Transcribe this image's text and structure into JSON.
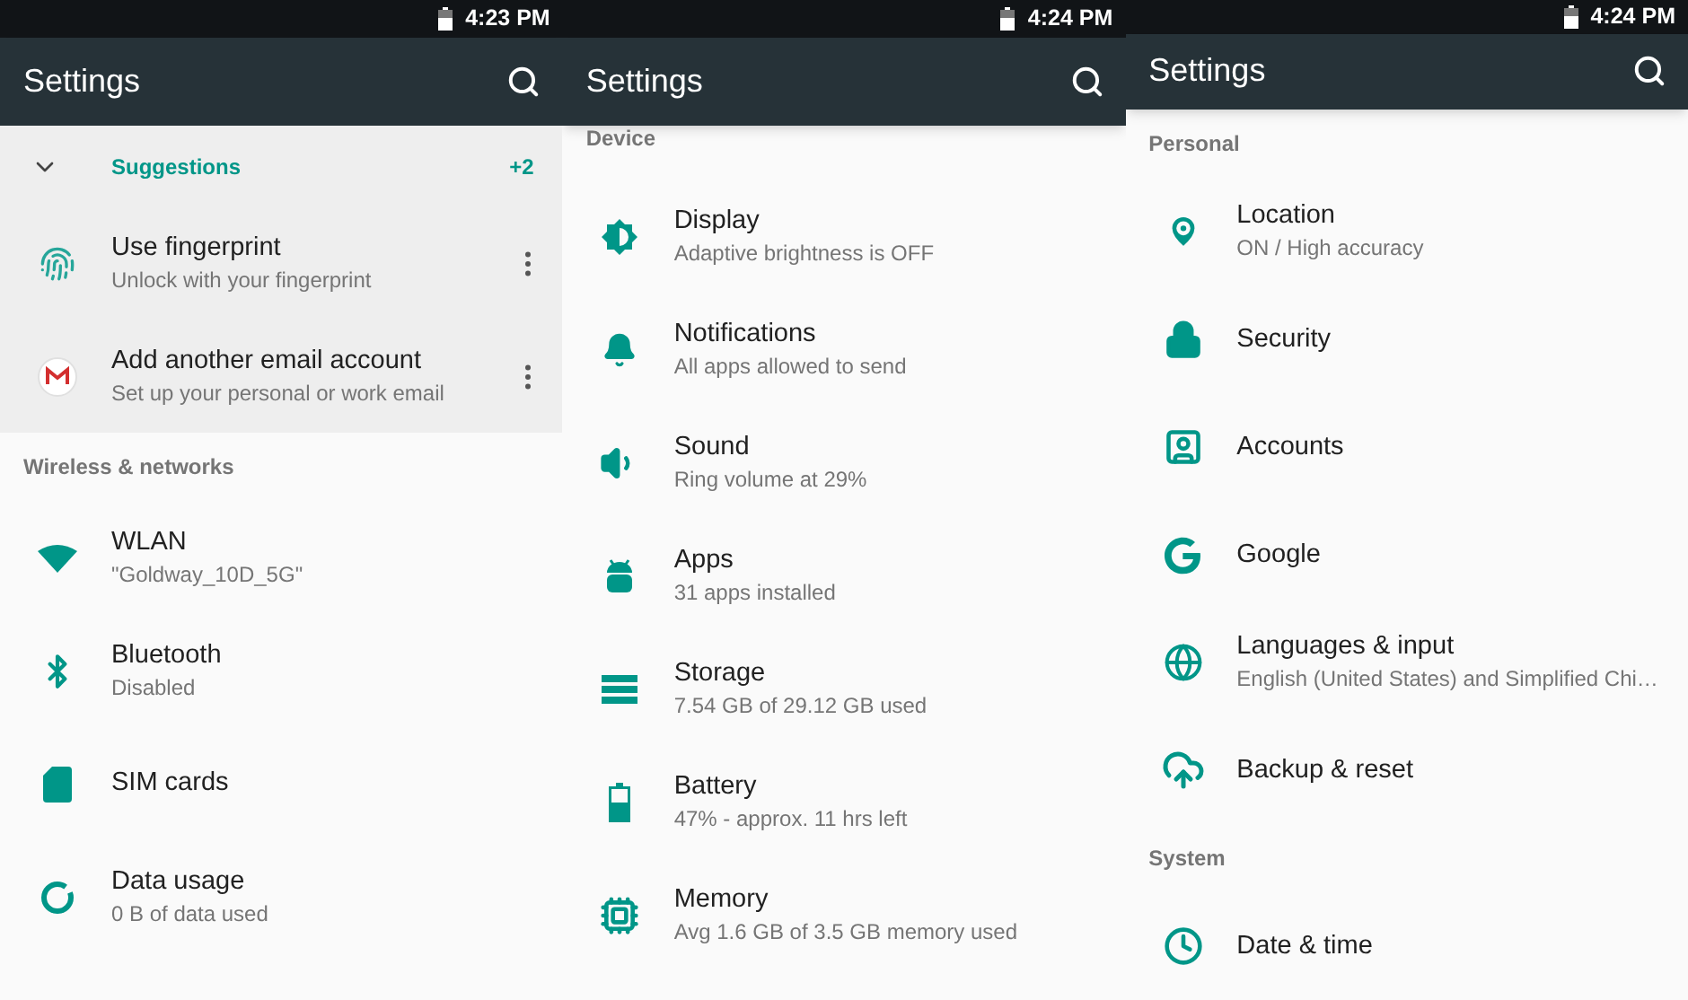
{
  "screens": [
    {
      "status_time": "4:23 PM",
      "title": "Settings",
      "suggestions": {
        "label": "Suggestions",
        "count": "+2",
        "expanded": false,
        "items": [
          {
            "title": "Use fingerprint",
            "subtitle": "Unlock with your fingerprint"
          },
          {
            "title": "Add another email account",
            "subtitle": "Set up your personal or work email"
          }
        ]
      },
      "sections": [
        {
          "header": "Wireless & networks",
          "items": [
            {
              "title": "WLAN",
              "subtitle": "\"Goldway_10D_5G\""
            },
            {
              "title": "Bluetooth",
              "subtitle": "Disabled"
            },
            {
              "title": "SIM cards"
            },
            {
              "title": "Data usage",
              "subtitle": "0 B of data used"
            }
          ]
        }
      ]
    },
    {
      "status_time": "4:24 PM",
      "title": "Settings",
      "sections": [
        {
          "header": "Device",
          "items": [
            {
              "title": "Display",
              "subtitle": "Adaptive brightness is OFF"
            },
            {
              "title": "Notifications",
              "subtitle": "All apps allowed to send"
            },
            {
              "title": "Sound",
              "subtitle": "Ring volume at 29%"
            },
            {
              "title": "Apps",
              "subtitle": "31 apps installed"
            },
            {
              "title": "Storage",
              "subtitle": "7.54 GB of 29.12 GB used"
            },
            {
              "title": "Battery",
              "subtitle": "47% - approx. 11 hrs left"
            },
            {
              "title": "Memory",
              "subtitle": "Avg 1.6 GB of 3.5 GB memory used"
            }
          ]
        }
      ]
    },
    {
      "status_time": "4:24 PM",
      "title": "Settings",
      "sections": [
        {
          "header": "Personal",
          "items": [
            {
              "title": "Location",
              "subtitle": "ON / High accuracy"
            },
            {
              "title": "Security"
            },
            {
              "title": "Accounts"
            },
            {
              "title": "Google"
            },
            {
              "title": "Languages & input",
              "subtitle": "English (United States) and Simplified Chi…"
            },
            {
              "title": "Backup & reset"
            }
          ]
        },
        {
          "header": "System",
          "items": [
            {
              "title": "Date & time"
            }
          ]
        }
      ]
    }
  ]
}
